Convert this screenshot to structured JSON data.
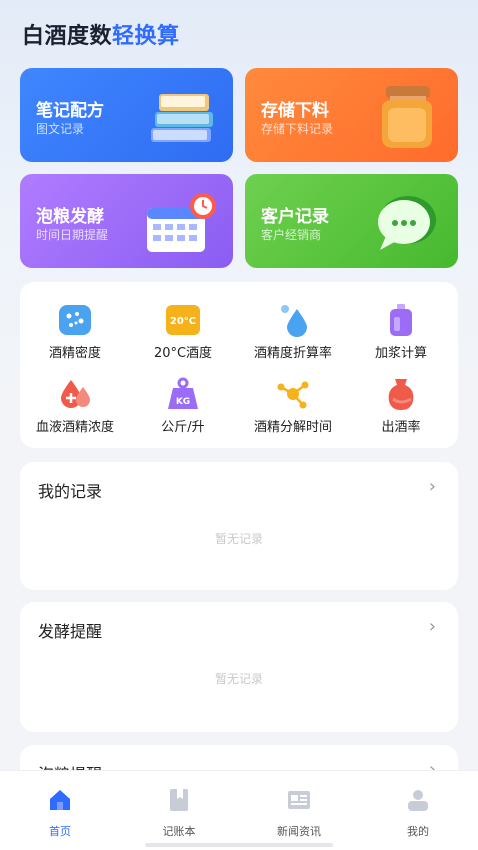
{
  "header": {
    "title_part1": "白酒度数",
    "title_part2": "轻换算"
  },
  "cards": [
    {
      "title": "笔记配方",
      "subtitle": "图文记录",
      "icon": "books-icon"
    },
    {
      "title": "存储下料",
      "subtitle": "存储下料记录",
      "icon": "honey-jar-icon"
    },
    {
      "title": "泡粮发酵",
      "subtitle": "时间日期提醒",
      "icon": "calendar-clock-icon"
    },
    {
      "title": "客户记录",
      "subtitle": "客户经销商",
      "icon": "chat-bubble-icon"
    }
  ],
  "tools": [
    {
      "label": "酒精密度",
      "icon": "dots-icon",
      "color": "#4aa3f0"
    },
    {
      "label": "20°C酒度",
      "icon": "thermo-badge-icon",
      "badge": "20°C",
      "color": "#f5b21a"
    },
    {
      "label": "酒精度折算率",
      "icon": "water-drop-icon",
      "color": "#4aa3f0"
    },
    {
      "label": "加浆计算",
      "icon": "bottle-icon",
      "color": "#9b6cf5"
    },
    {
      "label": "血液酒精浓度",
      "icon": "blood-drop-icon",
      "color": "#ef5a4a"
    },
    {
      "label": "公斤/升",
      "icon": "weight-icon",
      "badge": "KG",
      "color": "#9b6cf5"
    },
    {
      "label": "酒精分解时间",
      "icon": "molecule-icon",
      "color": "#f5b21a"
    },
    {
      "label": "出酒率",
      "icon": "jar-icon",
      "color": "#ef5a4a"
    }
  ],
  "sections": [
    {
      "title": "我的记录",
      "empty": "暂无记录"
    },
    {
      "title": "发酵提醒",
      "empty": "暂无记录"
    },
    {
      "title": "泡粮提醒"
    }
  ],
  "tabbar": [
    {
      "label": "首页",
      "icon": "home-icon",
      "active": true
    },
    {
      "label": "记账本",
      "icon": "notebook-icon",
      "active": false
    },
    {
      "label": "新闻资讯",
      "icon": "news-icon",
      "active": false
    },
    {
      "label": "我的",
      "icon": "profile-icon",
      "active": false
    }
  ],
  "colors": {
    "accent": "#2f6bff",
    "empty_text": "#c9c9c9"
  }
}
